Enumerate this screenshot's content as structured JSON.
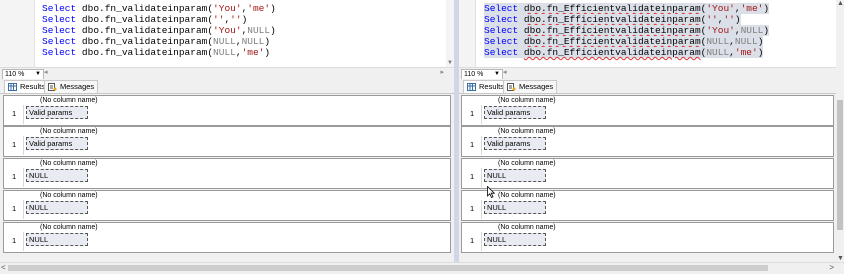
{
  "zoom": "110 %",
  "tabs": {
    "results": "Results",
    "messages": "Messages"
  },
  "column_header": "(No column name)",
  "left": {
    "lines": [
      {
        "kw": "Select",
        "fn": "dbo.fn_validateinparam",
        "args": [
          [
            "(",
            "p"
          ],
          [
            "'You'",
            "s"
          ],
          [
            ",",
            "p"
          ],
          [
            "'me'",
            "s"
          ],
          [
            ")",
            "p"
          ]
        ]
      },
      {
        "kw": "Select",
        "fn": "dbo.fn_validateinparam",
        "args": [
          [
            "(",
            "p"
          ],
          [
            "''",
            "s"
          ],
          [
            ",",
            "p"
          ],
          [
            "''",
            "s"
          ],
          [
            ")",
            "p"
          ]
        ]
      },
      {
        "kw": "Select",
        "fn": "dbo.fn_validateinparam",
        "args": [
          [
            "(",
            "p"
          ],
          [
            "'You'",
            "s"
          ],
          [
            ",",
            "p"
          ],
          [
            "NULL",
            "n"
          ],
          [
            ")",
            "p"
          ]
        ]
      },
      {
        "kw": "Select",
        "fn": "dbo.fn_validateinparam",
        "args": [
          [
            "(",
            "p"
          ],
          [
            "NULL",
            "n"
          ],
          [
            ",",
            "p"
          ],
          [
            "NULL",
            "n"
          ],
          [
            ")",
            "p"
          ]
        ]
      },
      {
        "kw": "Select",
        "fn": "dbo.fn_validateinparam",
        "args": [
          [
            "(",
            "p"
          ],
          [
            "NULL",
            "n"
          ],
          [
            ",",
            "p"
          ],
          [
            "'me'",
            "s"
          ],
          [
            ")",
            "p"
          ]
        ]
      }
    ],
    "results": [
      {
        "row": "1",
        "value": "Valid params"
      },
      {
        "row": "1",
        "value": "Valid params"
      },
      {
        "row": "1",
        "value": "NULL"
      },
      {
        "row": "1",
        "value": "NULL"
      },
      {
        "row": "1",
        "value": "NULL"
      }
    ]
  },
  "right": {
    "lines": [
      {
        "kw": "Select",
        "fn": "dbo.fn_Efficientvalidateinparam",
        "args": [
          [
            "(",
            "p"
          ],
          [
            "'You'",
            "s"
          ],
          [
            ",",
            "p"
          ],
          [
            "'me'",
            "s"
          ],
          [
            ")",
            "p"
          ]
        ]
      },
      {
        "kw": "Select",
        "fn": "dbo.fn_Efficientvalidateinparam",
        "args": [
          [
            "(",
            "p"
          ],
          [
            "''",
            "s"
          ],
          [
            ",",
            "p"
          ],
          [
            "''",
            "s"
          ],
          [
            ")",
            "p"
          ]
        ]
      },
      {
        "kw": "Select",
        "fn": "dbo.fn_Efficientvalidateinparam",
        "args": [
          [
            "(",
            "p"
          ],
          [
            "'You'",
            "s"
          ],
          [
            ",",
            "p"
          ],
          [
            "NULL",
            "n"
          ],
          [
            ")",
            "p"
          ]
        ]
      },
      {
        "kw": "Select",
        "fn": "dbo.fn_Efficientvalidateinparam",
        "args": [
          [
            "(",
            "p"
          ],
          [
            "NULL",
            "n"
          ],
          [
            ",",
            "p"
          ],
          [
            "NULL",
            "n"
          ],
          [
            ")",
            "p"
          ]
        ]
      },
      {
        "kw": "Select",
        "fn": "dbo.fn_Efficientvalidateinparam",
        "args": [
          [
            "(",
            "p"
          ],
          [
            "NULL",
            "n"
          ],
          [
            ",",
            "p"
          ],
          [
            "'me'",
            "s"
          ],
          [
            ")",
            "p"
          ]
        ]
      }
    ],
    "results": [
      {
        "row": "1",
        "value": "Valid params"
      },
      {
        "row": "1",
        "value": "Valid params"
      },
      {
        "row": "1",
        "value": "NULL"
      },
      {
        "row": "1",
        "value": "NULL"
      },
      {
        "row": "1",
        "value": "NULL"
      }
    ]
  },
  "colors": {
    "keyword": "#0000ff",
    "string": "#a31515",
    "null": "#808080",
    "squiggle": "#e03030"
  },
  "icons": {
    "results_tab": "grid-icon",
    "messages_tab": "messages-icon"
  }
}
